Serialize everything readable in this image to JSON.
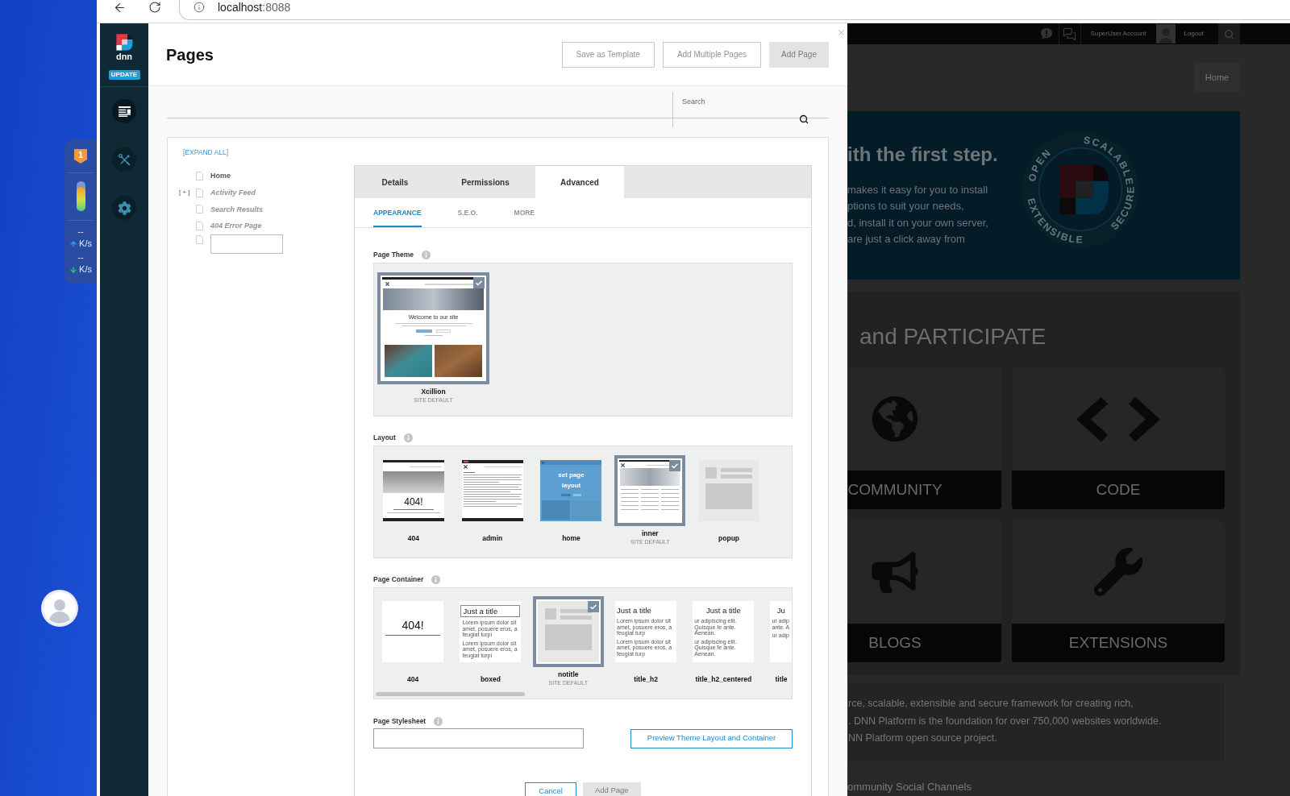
{
  "desktop": {
    "speed_widget": {
      "badge": "1",
      "level": 0.8,
      "upload": {
        "value": "--",
        "unit": "K/s"
      },
      "download": {
        "value": "--",
        "unit": "K/s"
      }
    }
  },
  "browser": {
    "address": {
      "host": "localhost",
      "port": ":8088"
    }
  },
  "persona_bar": {
    "logo_text": "dnn",
    "update_badge": "UPDATE",
    "items": [
      {
        "selected": true
      },
      {
        "selected": false
      },
      {
        "selected": false
      }
    ]
  },
  "pages_panel": {
    "title": "Pages",
    "header_buttons": [
      {
        "label": "Save as Template",
        "kind": "outline"
      },
      {
        "label": "Add Multiple Pages",
        "kind": "outline"
      },
      {
        "label": "Add Page",
        "kind": "filled"
      }
    ],
    "search": {
      "placeholder": "Search"
    },
    "tree": {
      "expand_all": "[EXPAND ALL]",
      "items": [
        {
          "kind": "page",
          "label": "Home",
          "disabled": false
        },
        {
          "kind": "page",
          "label": "Activity Feed",
          "disabled": true,
          "toggle": "[ + ]"
        },
        {
          "kind": "page",
          "label": "Search Results",
          "disabled": true
        },
        {
          "kind": "page",
          "label": "404 Error Page",
          "disabled": true
        },
        {
          "kind": "new-page",
          "disabled": false
        }
      ]
    },
    "tabs": [
      {
        "label": "Details",
        "selected": false
      },
      {
        "label": "Permissions",
        "selected": false
      },
      {
        "label": "Advanced",
        "selected": true
      }
    ],
    "subtabs": [
      {
        "label": "APPEARANCE",
        "selected": true
      },
      {
        "label": "S.E.O.",
        "selected": false
      },
      {
        "label": "MORE",
        "selected": false
      }
    ],
    "page_theme": {
      "label": "Page Theme",
      "items": [
        {
          "name": "Xcillion",
          "note": "SITE DEFAULT",
          "selected": true,
          "kind": "site-preview",
          "heading": "Welcome to our site"
        }
      ]
    },
    "layout": {
      "label": "Layout",
      "items": [
        {
          "name": "404",
          "selected": false,
          "kind": "error-layout",
          "heading": "404!"
        },
        {
          "name": "admin",
          "selected": false,
          "kind": "text-page"
        },
        {
          "name": "home",
          "selected": false,
          "kind": "overlay",
          "heading": "set page layout"
        },
        {
          "name": "inner",
          "note": "SITE DEFAULT",
          "selected": true,
          "kind": "dashboard"
        },
        {
          "name": "popup",
          "selected": false,
          "kind": "wireframe"
        }
      ]
    },
    "page_container": {
      "label": "Page Container",
      "items": [
        {
          "name": "404",
          "selected": false,
          "clipped": false,
          "kind": "error-container",
          "heading": "404!"
        },
        {
          "name": "boxed",
          "selected": false,
          "clipped": false,
          "kind": "boxed",
          "heading": "Just a title",
          "paragraphs": [
            [
              "Lorem ipsum dolor sit amet,",
              "posuere eros, a feugiat turpi"
            ],
            [
              "Lorem ipsum dolor sit amet,",
              "posuere eros, a feugiat turpi"
            ]
          ]
        },
        {
          "name": "notitle",
          "note": "SITE DEFAULT",
          "selected": true,
          "clipped": false,
          "kind": "wireframe"
        },
        {
          "name": "title_h2",
          "selected": false,
          "clipped": false,
          "kind": "titled",
          "heading": "Just a title",
          "paragraphs": [
            [
              "Lorem ipsum dolor sit amet,",
              "posuere eros, a feugiat turp"
            ],
            [
              "Lorem ipsum dolor sit amet,",
              "posuere eros, a feugiat turp"
            ]
          ]
        },
        {
          "name": "title_h2_centered",
          "selected": false,
          "clipped": false,
          "kind": "centered",
          "heading": "Just a title",
          "paragraphs": [
            [
              "ur adipiscing elit. Quisque fe",
              "ante. Aenean."
            ],
            [
              "ur adipiscing elit. Quisque fe",
              "ante. Aenean."
            ]
          ]
        },
        {
          "name": "title",
          "selected": false,
          "clipped": true,
          "kind": "centered",
          "heading": "Ju",
          "paragraphs": [
            [
              "ur adip",
              "ante. A"
            ],
            [
              "ur adip"
            ]
          ]
        }
      ]
    },
    "page_stylesheet": {
      "label": "Page Stylesheet"
    },
    "preview_button": "Preview Theme Layout and Container",
    "footer_buttons": [
      {
        "label": "Cancel",
        "kind": "outline"
      },
      {
        "label": "Add Page",
        "kind": "filled"
      }
    ]
  },
  "site": {
    "top_bar": {
      "account": "SuperUser Account",
      "logout": "Logout"
    },
    "menu": [
      "Home"
    ],
    "banner": {
      "heading": "ith the first step.",
      "lines": [
        "makes it easy for you to install",
        "ptions to suit your needs,",
        "d, install it on your own server,",
        "are just a click away from"
      ],
      "seal_words": [
        "OPEN",
        "SCALABLE",
        "EXTENSIBLE",
        "SECURE"
      ]
    },
    "section_heading": "and PARTICIPATE",
    "cards": [
      {
        "label": "COMMUNITY",
        "clipped": true
      },
      {
        "label": "CODE",
        "clipped": false
      },
      {
        "label": "BLOGS",
        "clipped": true
      },
      {
        "label": "EXTENSIONS",
        "clipped": false
      }
    ],
    "about_lines": [
      "rce, scalable, extensible and secure framework for creating rich,",
      ". DNN Platform is the foundation for over 750,000 websites worldwide.",
      "NN Platform open source project."
    ],
    "social_heading": "ommunity Social Channels"
  }
}
